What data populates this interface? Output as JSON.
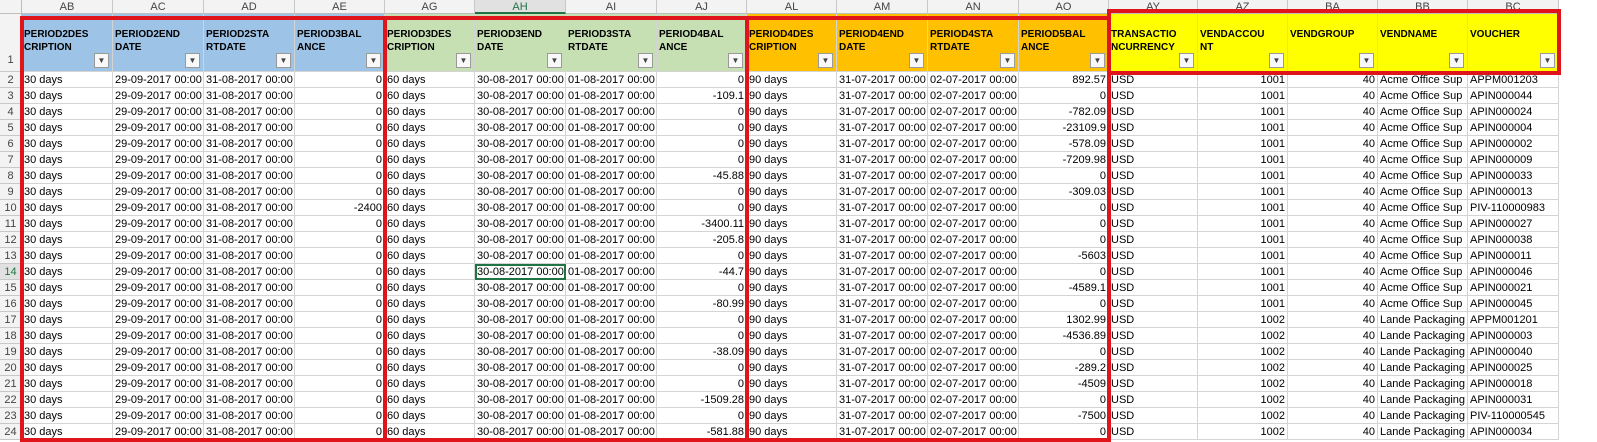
{
  "colors": {
    "blue": "#9dc3e6",
    "green": "#c6e0b4",
    "orange": "#ffc000",
    "yellow": "#ffff00",
    "highlight_red": "#e0151c",
    "grid_line": "#d4d4d4",
    "header_bg": "#f3f3f3",
    "active_green": "#217346"
  },
  "filter_icon": "dropdown-arrow-icon",
  "columns": [
    {
      "letter": "AB",
      "header": "PERIOD2DESCRIPTION",
      "type": "text",
      "color": "blue"
    },
    {
      "letter": "AC",
      "header": "PERIOD2ENDDATE",
      "type": "text",
      "color": "blue"
    },
    {
      "letter": "AD",
      "header": "PERIOD2STARTDATE",
      "type": "text",
      "color": "blue"
    },
    {
      "letter": "AE",
      "header": "PERIOD3BALANCE",
      "type": "num",
      "color": "blue"
    },
    {
      "letter": "AG",
      "header": "PERIOD3DESCRIPTION",
      "type": "text",
      "color": "green"
    },
    {
      "letter": "AH",
      "header": "PERIOD3ENDDATE",
      "type": "text",
      "color": "green"
    },
    {
      "letter": "AI",
      "header": "PERIOD3STARTDATE",
      "type": "text",
      "color": "green"
    },
    {
      "letter": "AJ",
      "header": "PERIOD4BALANCE",
      "type": "num",
      "color": "green"
    },
    {
      "letter": "AL",
      "header": "PERIOD4DESCRIPTION",
      "type": "text",
      "color": "orange"
    },
    {
      "letter": "AM",
      "header": "PERIOD4ENDDATE",
      "type": "text",
      "color": "orange"
    },
    {
      "letter": "AN",
      "header": "PERIOD4STARTDATE",
      "type": "text",
      "color": "orange"
    },
    {
      "letter": "AO",
      "header": "PERIOD5BALANCE",
      "type": "num",
      "color": "orange"
    },
    {
      "letter": "AY",
      "header": "TRANSACTIONCURRENCY",
      "type": "text",
      "color": "yellow"
    },
    {
      "letter": "AZ",
      "header": "VENDACCOUNT",
      "type": "num",
      "color": "yellow"
    },
    {
      "letter": "BA",
      "header": "VENDGROUP",
      "type": "num",
      "color": "yellow"
    },
    {
      "letter": "BB",
      "header": "VENDNAME",
      "type": "text",
      "color": "yellow"
    },
    {
      "letter": "BC",
      "header": "VOUCHER",
      "type": "text",
      "color": "yellow"
    }
  ],
  "active_cell": {
    "row": 14,
    "column": "AH"
  },
  "rows": [
    {
      "n": "2",
      "cells": [
        "30 days",
        "29-09-2017 00:00",
        "31-08-2017 00:00",
        "0",
        "60 days",
        "30-08-2017 00:00",
        "01-08-2017 00:00",
        "0",
        "90 days",
        "31-07-2017 00:00",
        "02-07-2017 00:00",
        "892.57",
        "USD",
        "1001",
        "40",
        "Acme Office Sup",
        "APPM001203"
      ]
    },
    {
      "n": "3",
      "cells": [
        "30 days",
        "29-09-2017 00:00",
        "31-08-2017 00:00",
        "0",
        "60 days",
        "30-08-2017 00:00",
        "01-08-2017 00:00",
        "-109.1",
        "90 days",
        "31-07-2017 00:00",
        "02-07-2017 00:00",
        "0",
        "USD",
        "1001",
        "40",
        "Acme Office Sup",
        "APIN000044"
      ]
    },
    {
      "n": "4",
      "cells": [
        "30 days",
        "29-09-2017 00:00",
        "31-08-2017 00:00",
        "0",
        "60 days",
        "30-08-2017 00:00",
        "01-08-2017 00:00",
        "0",
        "90 days",
        "31-07-2017 00:00",
        "02-07-2017 00:00",
        "-782.09",
        "USD",
        "1001",
        "40",
        "Acme Office Sup",
        "APIN000024"
      ]
    },
    {
      "n": "5",
      "cells": [
        "30 days",
        "29-09-2017 00:00",
        "31-08-2017 00:00",
        "0",
        "60 days",
        "30-08-2017 00:00",
        "01-08-2017 00:00",
        "0",
        "90 days",
        "31-07-2017 00:00",
        "02-07-2017 00:00",
        "-23109.9",
        "USD",
        "1001",
        "40",
        "Acme Office Sup",
        "APIN000004"
      ]
    },
    {
      "n": "6",
      "cells": [
        "30 days",
        "29-09-2017 00:00",
        "31-08-2017 00:00",
        "0",
        "60 days",
        "30-08-2017 00:00",
        "01-08-2017 00:00",
        "0",
        "90 days",
        "31-07-2017 00:00",
        "02-07-2017 00:00",
        "-578.09",
        "USD",
        "1001",
        "40",
        "Acme Office Sup",
        "APIN000002"
      ]
    },
    {
      "n": "7",
      "cells": [
        "30 days",
        "29-09-2017 00:00",
        "31-08-2017 00:00",
        "0",
        "60 days",
        "30-08-2017 00:00",
        "01-08-2017 00:00",
        "0",
        "90 days",
        "31-07-2017 00:00",
        "02-07-2017 00:00",
        "-7209.98",
        "USD",
        "1001",
        "40",
        "Acme Office Sup",
        "APIN000009"
      ]
    },
    {
      "n": "8",
      "cells": [
        "30 days",
        "29-09-2017 00:00",
        "31-08-2017 00:00",
        "0",
        "60 days",
        "30-08-2017 00:00",
        "01-08-2017 00:00",
        "-45.88",
        "90 days",
        "31-07-2017 00:00",
        "02-07-2017 00:00",
        "0",
        "USD",
        "1001",
        "40",
        "Acme Office Sup",
        "APIN000033"
      ]
    },
    {
      "n": "9",
      "cells": [
        "30 days",
        "29-09-2017 00:00",
        "31-08-2017 00:00",
        "0",
        "60 days",
        "30-08-2017 00:00",
        "01-08-2017 00:00",
        "0",
        "90 days",
        "31-07-2017 00:00",
        "02-07-2017 00:00",
        "-309.03",
        "USD",
        "1001",
        "40",
        "Acme Office Sup",
        "APIN000013"
      ]
    },
    {
      "n": "10",
      "cells": [
        "30 days",
        "29-09-2017 00:00",
        "31-08-2017 00:00",
        "-2400",
        "60 days",
        "30-08-2017 00:00",
        "01-08-2017 00:00",
        "0",
        "90 days",
        "31-07-2017 00:00",
        "02-07-2017 00:00",
        "0",
        "USD",
        "1001",
        "40",
        "Acme Office Sup",
        "PIV-110000983"
      ]
    },
    {
      "n": "11",
      "cells": [
        "30 days",
        "29-09-2017 00:00",
        "31-08-2017 00:00",
        "0",
        "60 days",
        "30-08-2017 00:00",
        "01-08-2017 00:00",
        "-3400.11",
        "90 days",
        "31-07-2017 00:00",
        "02-07-2017 00:00",
        "0",
        "USD",
        "1001",
        "40",
        "Acme Office Sup",
        "APIN000027"
      ]
    },
    {
      "n": "12",
      "cells": [
        "30 days",
        "29-09-2017 00:00",
        "31-08-2017 00:00",
        "0",
        "60 days",
        "30-08-2017 00:00",
        "01-08-2017 00:00",
        "-205.8",
        "90 days",
        "31-07-2017 00:00",
        "02-07-2017 00:00",
        "0",
        "USD",
        "1001",
        "40",
        "Acme Office Sup",
        "APIN000038"
      ]
    },
    {
      "n": "13",
      "cells": [
        "30 days",
        "29-09-2017 00:00",
        "31-08-2017 00:00",
        "0",
        "60 days",
        "30-08-2017 00:00",
        "01-08-2017 00:00",
        "0",
        "90 days",
        "31-07-2017 00:00",
        "02-07-2017 00:00",
        "-5603",
        "USD",
        "1001",
        "40",
        "Acme Office Sup",
        "APIN000011"
      ]
    },
    {
      "n": "14",
      "cells": [
        "30 days",
        "29-09-2017 00:00",
        "31-08-2017 00:00",
        "0",
        "60 days",
        "30-08-2017 00:00",
        "01-08-2017 00:00",
        "-44.7",
        "90 days",
        "31-07-2017 00:00",
        "02-07-2017 00:00",
        "0",
        "USD",
        "1001",
        "40",
        "Acme Office Sup",
        "APIN000046"
      ]
    },
    {
      "n": "15",
      "cells": [
        "30 days",
        "29-09-2017 00:00",
        "31-08-2017 00:00",
        "0",
        "60 days",
        "30-08-2017 00:00",
        "01-08-2017 00:00",
        "0",
        "90 days",
        "31-07-2017 00:00",
        "02-07-2017 00:00",
        "-4589.1",
        "USD",
        "1001",
        "40",
        "Acme Office Sup",
        "APIN000021"
      ]
    },
    {
      "n": "16",
      "cells": [
        "30 days",
        "29-09-2017 00:00",
        "31-08-2017 00:00",
        "0",
        "60 days",
        "30-08-2017 00:00",
        "01-08-2017 00:00",
        "-80.99",
        "90 days",
        "31-07-2017 00:00",
        "02-07-2017 00:00",
        "0",
        "USD",
        "1001",
        "40",
        "Acme Office Sup",
        "APIN000045"
      ]
    },
    {
      "n": "17",
      "cells": [
        "30 days",
        "29-09-2017 00:00",
        "31-08-2017 00:00",
        "0",
        "60 days",
        "30-08-2017 00:00",
        "01-08-2017 00:00",
        "0",
        "90 days",
        "31-07-2017 00:00",
        "02-07-2017 00:00",
        "1302.99",
        "USD",
        "1002",
        "40",
        "Lande Packaging",
        "APPM001201"
      ]
    },
    {
      "n": "18",
      "cells": [
        "30 days",
        "29-09-2017 00:00",
        "31-08-2017 00:00",
        "0",
        "60 days",
        "30-08-2017 00:00",
        "01-08-2017 00:00",
        "0",
        "90 days",
        "31-07-2017 00:00",
        "02-07-2017 00:00",
        "-4536.89",
        "USD",
        "1002",
        "40",
        "Lande Packaging",
        "APIN000003"
      ]
    },
    {
      "n": "19",
      "cells": [
        "30 days",
        "29-09-2017 00:00",
        "31-08-2017 00:00",
        "0",
        "60 days",
        "30-08-2017 00:00",
        "01-08-2017 00:00",
        "-38.09",
        "90 days",
        "31-07-2017 00:00",
        "02-07-2017 00:00",
        "0",
        "USD",
        "1002",
        "40",
        "Lande Packaging",
        "APIN000040"
      ]
    },
    {
      "n": "20",
      "cells": [
        "30 days",
        "29-09-2017 00:00",
        "31-08-2017 00:00",
        "0",
        "60 days",
        "30-08-2017 00:00",
        "01-08-2017 00:00",
        "0",
        "90 days",
        "31-07-2017 00:00",
        "02-07-2017 00:00",
        "-289.2",
        "USD",
        "1002",
        "40",
        "Lande Packaging",
        "APIN000025"
      ]
    },
    {
      "n": "21",
      "cells": [
        "30 days",
        "29-09-2017 00:00",
        "31-08-2017 00:00",
        "0",
        "60 days",
        "30-08-2017 00:00",
        "01-08-2017 00:00",
        "0",
        "90 days",
        "31-07-2017 00:00",
        "02-07-2017 00:00",
        "-4509",
        "USD",
        "1002",
        "40",
        "Lande Packaging",
        "APIN000018"
      ]
    },
    {
      "n": "22",
      "cells": [
        "30 days",
        "29-09-2017 00:00",
        "31-08-2017 00:00",
        "0",
        "60 days",
        "30-08-2017 00:00",
        "01-08-2017 00:00",
        "-1509.28",
        "90 days",
        "31-07-2017 00:00",
        "02-07-2017 00:00",
        "0",
        "USD",
        "1002",
        "40",
        "Lande Packaging",
        "APIN000031"
      ]
    },
    {
      "n": "23",
      "cells": [
        "30 days",
        "29-09-2017 00:00",
        "31-08-2017 00:00",
        "0",
        "60 days",
        "30-08-2017 00:00",
        "01-08-2017 00:00",
        "0",
        "90 days",
        "31-07-2017 00:00",
        "02-07-2017 00:00",
        "-7500",
        "USD",
        "1002",
        "40",
        "Lande Packaging",
        "PIV-110000545"
      ]
    },
    {
      "n": "24",
      "cells": [
        "30 days",
        "29-09-2017 00:00",
        "31-08-2017 00:00",
        "0",
        "60 days",
        "30-08-2017 00:00",
        "01-08-2017 00:00",
        "-581.88",
        "90 days",
        "31-07-2017 00:00",
        "02-07-2017 00:00",
        "0",
        "USD",
        "1002",
        "40",
        "Lande Packaging",
        "APIN000034"
      ]
    }
  ]
}
